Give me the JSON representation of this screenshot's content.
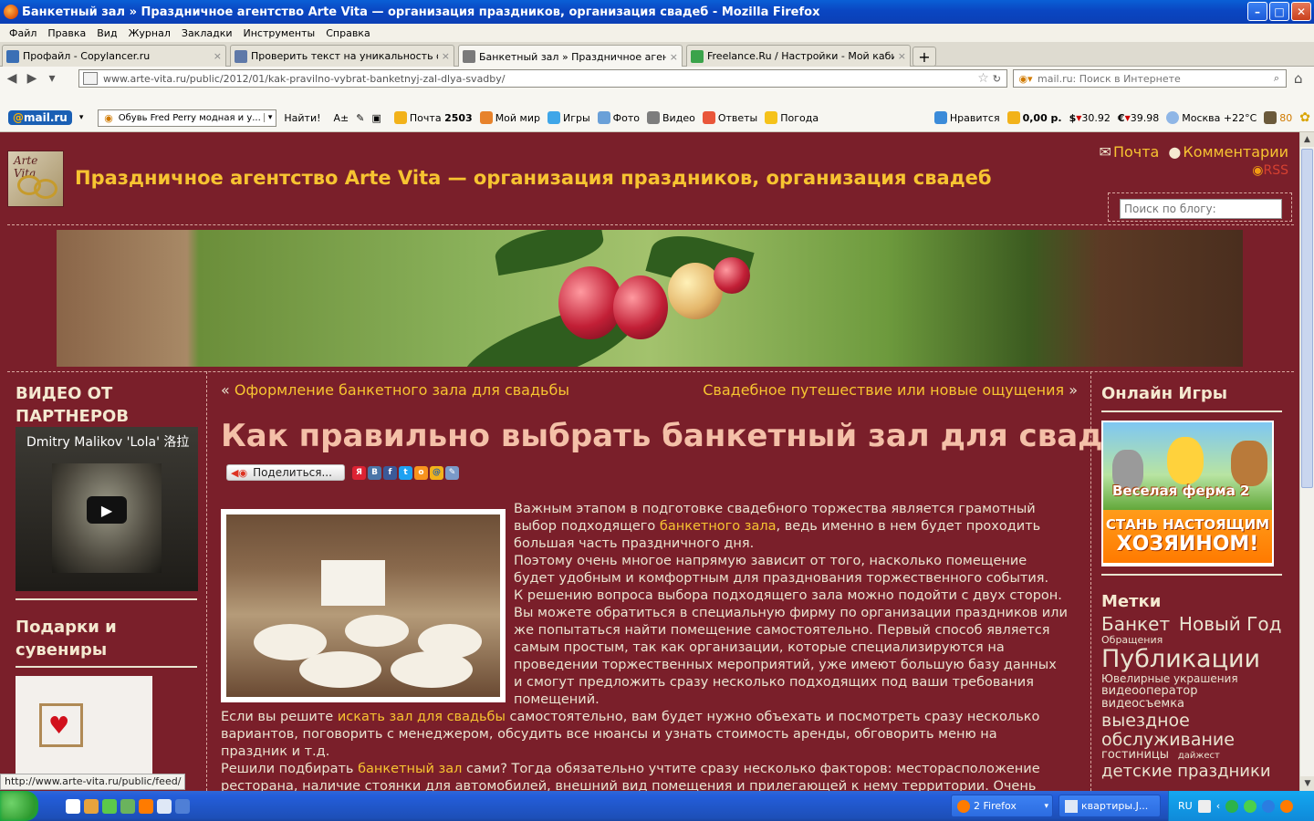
{
  "window": {
    "title": "Банкетный зал » Праздничное агентство Arte Vita — организация праздников, организация свадеб - Mozilla Firefox",
    "minimize": "–",
    "maximize": "□",
    "close": "✕"
  },
  "menu": [
    "Файл",
    "Правка",
    "Вид",
    "Журнал",
    "Закладки",
    "Инструменты",
    "Справка"
  ],
  "tabs": [
    {
      "label": "Профайл - Copylancer.ru",
      "color": "#3a6fb5"
    },
    {
      "label": "Проверить текст на уникальность онл...",
      "color": "#5f79a8"
    },
    {
      "label": "Банкетный зал » Праздничное агентст...",
      "color": "#7a7a7a"
    },
    {
      "label": "Freelance.Ru / Настройки - Мой кабинет",
      "color": "#3aa34a"
    }
  ],
  "tab_new": "+",
  "tab_close": "×",
  "nav": {
    "url": "www.arte-vita.ru/public/2012/01/kak-pravilno-vybrat-banketnyj-zal-dlya-svadby/",
    "search_placeholder": "mail.ru: Поиск в Интернете"
  },
  "mailru_toolbar": {
    "logo": "mail.ru",
    "search_value": "Обувь Fred Perry модная и у...",
    "find": "Найти!",
    "items": [
      {
        "label": "Почта",
        "count": "2503"
      },
      {
        "label": "Мой мир"
      },
      {
        "label": "Игры"
      },
      {
        "label": "Фото"
      },
      {
        "label": "Видео"
      },
      {
        "label": "Ответы"
      },
      {
        "label": "Погода"
      }
    ],
    "right": {
      "like": "Нравится",
      "money": "0,00 р.",
      "usd": "30.92",
      "eur": "39.98",
      "weather": "Москва +22°С",
      "counter": "80"
    }
  },
  "site": {
    "logo_text": "Arte Vita",
    "title": "Праздничное агентство Arte Vita — организация праздников, организация свадеб",
    "mail": "Почта",
    "comments": "Комментарии",
    "rss": "RSS",
    "search_placeholder": "Поиск по блогу:"
  },
  "left": {
    "video_heading": "ВИДЕО ОТ ПАРТНЕРОВ",
    "video_title": "Dmitry Malikov 'Lola' 洛拉",
    "gifts_heading": "Подарки и сувениры"
  },
  "post": {
    "prev": "Оформление банкетного зала для свадьбы",
    "next": "Свадебное путешествие или новые ощущения",
    "title": "Как правильно выбрать банкетный зал для свадьбы",
    "share": "Поделиться...",
    "p1_a": "Важным этапом в подготовке свадебного торжества является грамотный выбор подходящего ",
    "p1_link": "банкетного зала",
    "p1_b": ", ведь именно в нем будет проходить большая часть праздничного дня.",
    "p2": "Поэтому очень многое напрямую зависит от того, насколько помещение будет удобным и комфортным для празднования торжественного события.",
    "p3": "К решению вопроса выбора подходящего зала можно подойти с двух сторон. Вы можете обратиться в специальную фирму по организации праздников или же попытаться найти помещение самостоятельно. Первый способ является самым простым, так как организации, которые специализируются на проведении торжественных мероприятий, уже имеют большую базу данных и смогут предложить сразу несколько подходящих под ваши требования помещений.",
    "p4_a": "Если вы решите ",
    "p4_link": "искать зал для свадьбы",
    "p4_b": " самостоятельно, вам будет нужно объехать и посмотреть сразу несколько вариантов, поговорить с менеджером, обсудить все нюансы и узнать стоимость аренды, обговорить меню на праздник и т.д.",
    "p5_a": "Решили подбирать ",
    "p5_link": "банкетный зал",
    "p5_b": " сами? Тогда обязательно учтите сразу несколько факторов: месторасположение ресторана, наличие стоянки для автомобилей, внешний вид помещения и прилегающей к нему территории. Очень важен и интерьер. Посмотрите на дизайн зала, который вы хотите взять в аренду. Узнайте, кто будет заниматься его украшением"
  },
  "right": {
    "games_heading": "Онлайн Игры",
    "game_logo": "Веселая ферма 2",
    "game_promo_1": "СТАНЬ НАСТОЯЩИМ",
    "game_promo_2": "ХОЗЯИНОМ!",
    "tags_heading": "Метки",
    "tags": [
      {
        "text": "Банкет",
        "size": 20
      },
      {
        "text": "Новый Год",
        "size": 20
      },
      {
        "text": "Обращения",
        "size": 11
      },
      {
        "text": "Публикации",
        "size": 27
      },
      {
        "text": "Ювелирные украшения",
        "size": 12
      },
      {
        "text": "видеооператор",
        "size": 13
      },
      {
        "text": "видеосъемка",
        "size": 13
      },
      {
        "text": "выездное обслуживание",
        "size": 19
      },
      {
        "text": "гостиницы",
        "size": 13
      },
      {
        "text": "дайжест",
        "size": 10
      },
      {
        "text": "детские праздники",
        "size": 18
      }
    ]
  },
  "status_url": "http://www.arte-vita.ru/public/feed/",
  "taskbar": {
    "firefox": "2 Firefox",
    "other": "квартиры.J...",
    "lang": "RU"
  }
}
